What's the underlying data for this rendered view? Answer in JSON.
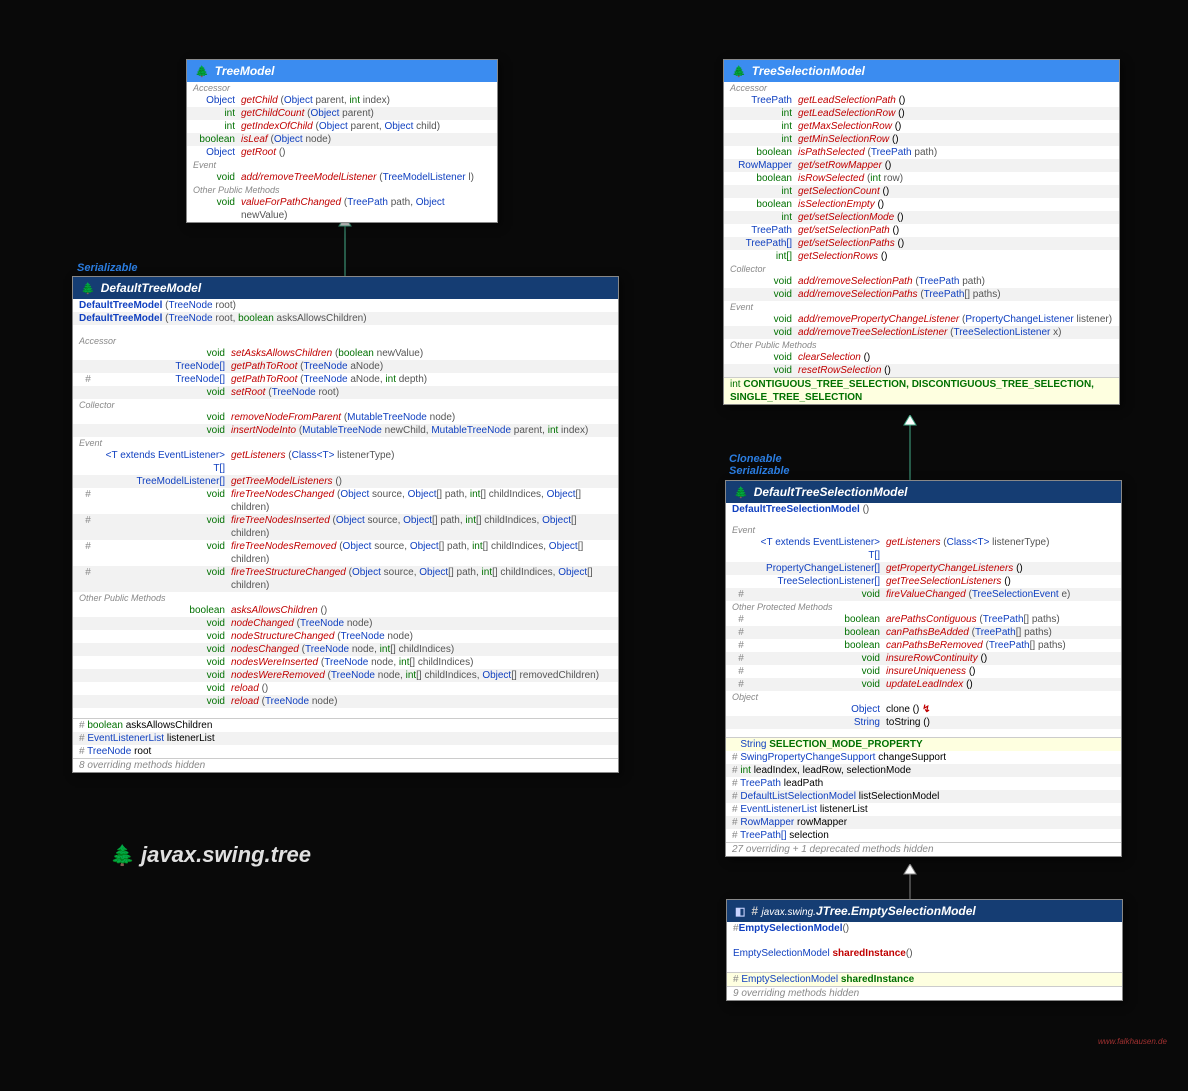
{
  "package_label": "javax.swing.tree",
  "watermark": "www.falkhausen.de",
  "stereotypes": {
    "serializable": "Serializable",
    "cloneable": "Cloneable"
  },
  "tree_model": {
    "title": "TreeModel",
    "sections": {
      "accessor": "Accessor",
      "event": "Event",
      "other": "Other Public Methods"
    },
    "rows": [
      {
        "ret": "Object",
        "retClass": "t-type",
        "name": "getChild",
        "params": "(Object parent, int index)"
      },
      {
        "ret": "int",
        "retClass": "t-prim",
        "name": "getChildCount",
        "params": "(Object parent)"
      },
      {
        "ret": "int",
        "retClass": "t-prim",
        "name": "getIndexOfChild",
        "params": "(Object parent, Object child)"
      },
      {
        "ret": "boolean",
        "retClass": "t-prim",
        "name": "isLeaf",
        "params": "(Object node)"
      },
      {
        "ret": "Object",
        "retClass": "t-type",
        "name": "getRoot",
        "params": "()"
      }
    ],
    "event_row": {
      "ret": "void",
      "retClass": "t-prim",
      "name": "add/removeTreeModelListener",
      "params": "(TreeModelListener l)"
    },
    "other_row": {
      "ret": "void",
      "retClass": "t-prim",
      "name": "valueForPathChanged",
      "params": "(TreePath path, Object newValue)"
    }
  },
  "default_tree_model": {
    "title": "DefaultTreeModel",
    "ctors": [
      {
        "name": "DefaultTreeModel",
        "params": "(TreeNode root)"
      },
      {
        "name": "DefaultTreeModel",
        "params": "(TreeNode root, boolean asksAllowsChildren)"
      }
    ],
    "sections": {
      "accessor": "Accessor",
      "collector": "Collector",
      "event": "Event",
      "other": "Other Public Methods"
    },
    "accessor": [
      {
        "mod": "",
        "ret": "void",
        "retClass": "t-prim",
        "name": "setAsksAllowsChildren",
        "params": "(boolean newValue)"
      },
      {
        "mod": "",
        "ret": "TreeNode[]",
        "retClass": "t-type",
        "name": "getPathToRoot",
        "params": "(TreeNode aNode)"
      },
      {
        "mod": "#",
        "ret": "TreeNode[]",
        "retClass": "t-type",
        "name": "getPathToRoot",
        "params": "(TreeNode aNode, int depth)"
      },
      {
        "mod": "",
        "ret": "void",
        "retClass": "t-prim",
        "name": "setRoot",
        "params": "(TreeNode root)"
      }
    ],
    "collector": [
      {
        "mod": "",
        "ret": "void",
        "retClass": "t-prim",
        "name": "removeNodeFromParent",
        "params": "(MutableTreeNode node)"
      },
      {
        "mod": "",
        "ret": "void",
        "retClass": "t-prim",
        "name": "insertNodeInto",
        "params": "(MutableTreeNode newChild, MutableTreeNode parent, int index)"
      }
    ],
    "event": [
      {
        "mod": "",
        "ret": "<T extends EventListener> T[]",
        "retClass": "t-type",
        "name": "getListeners",
        "params": "(Class<T> listenerType)"
      },
      {
        "mod": "",
        "ret": "TreeModelListener[]",
        "retClass": "t-type",
        "name": "getTreeModelListeners",
        "params": "()"
      },
      {
        "mod": "#",
        "ret": "void",
        "retClass": "t-prim",
        "name": "fireTreeNodesChanged",
        "params": "(Object source, Object[] path, int[] childIndices, Object[] children)"
      },
      {
        "mod": "#",
        "ret": "void",
        "retClass": "t-prim",
        "name": "fireTreeNodesInserted",
        "params": "(Object source, Object[] path, int[] childIndices, Object[] children)"
      },
      {
        "mod": "#",
        "ret": "void",
        "retClass": "t-prim",
        "name": "fireTreeNodesRemoved",
        "params": "(Object source, Object[] path, int[] childIndices, Object[] children)"
      },
      {
        "mod": "#",
        "ret": "void",
        "retClass": "t-prim",
        "name": "fireTreeStructureChanged",
        "params": "(Object source, Object[] path, int[] childIndices, Object[] children)"
      }
    ],
    "other": [
      {
        "mod": "",
        "ret": "boolean",
        "retClass": "t-prim",
        "name": "asksAllowsChildren",
        "params": "()"
      },
      {
        "mod": "",
        "ret": "void",
        "retClass": "t-prim",
        "name": "nodeChanged",
        "params": "(TreeNode node)"
      },
      {
        "mod": "",
        "ret": "void",
        "retClass": "t-prim",
        "name": "nodeStructureChanged",
        "params": "(TreeNode node)"
      },
      {
        "mod": "",
        "ret": "void",
        "retClass": "t-prim",
        "name": "nodesChanged",
        "params": "(TreeNode node, int[] childIndices)"
      },
      {
        "mod": "",
        "ret": "void",
        "retClass": "t-prim",
        "name": "nodesWereInserted",
        "params": "(TreeNode node, int[] childIndices)"
      },
      {
        "mod": "",
        "ret": "void",
        "retClass": "t-prim",
        "name": "nodesWereRemoved",
        "params": "(TreeNode node, int[] childIndices, Object[] removedChildren)"
      },
      {
        "mod": "",
        "ret": "void",
        "retClass": "t-prim",
        "name": "reload",
        "params": "()"
      },
      {
        "mod": "",
        "ret": "void",
        "retClass": "t-prim",
        "name": "reload",
        "params": "(TreeNode node)"
      }
    ],
    "fields": [
      {
        "mod": "#",
        "type": "boolean",
        "typeClass": "t-prim",
        "name": "asksAllowsChildren"
      },
      {
        "mod": "#",
        "type": "EventListenerList",
        "typeClass": "t-type",
        "name": "listenerList"
      },
      {
        "mod": "#",
        "type": "TreeNode",
        "typeClass": "t-type",
        "name": "root"
      }
    ],
    "footnote": "8 overriding methods hidden"
  },
  "tree_selection_model": {
    "title": "TreeSelectionModel",
    "sections": {
      "accessor": "Accessor",
      "collector": "Collector",
      "event": "Event",
      "other": "Other Public Methods"
    },
    "accessor": [
      {
        "ret": "TreePath",
        "retClass": "t-type",
        "name": "getLeadSelectionPath",
        "params": "()"
      },
      {
        "ret": "int",
        "retClass": "t-prim",
        "name": "getLeadSelectionRow",
        "params": "()"
      },
      {
        "ret": "int",
        "retClass": "t-prim",
        "name": "getMaxSelectionRow",
        "params": "()"
      },
      {
        "ret": "int",
        "retClass": "t-prim",
        "name": "getMinSelectionRow",
        "params": "()"
      },
      {
        "ret": "boolean",
        "retClass": "t-prim",
        "name": "isPathSelected",
        "params": "(TreePath path)"
      },
      {
        "ret": "RowMapper",
        "retClass": "t-type",
        "name": "get/setRowMapper",
        "params": "()"
      },
      {
        "ret": "boolean",
        "retClass": "t-prim",
        "name": "isRowSelected",
        "params": "(int row)"
      },
      {
        "ret": "int",
        "retClass": "t-prim",
        "name": "getSelectionCount",
        "params": "()"
      },
      {
        "ret": "boolean",
        "retClass": "t-prim",
        "name": "isSelectionEmpty",
        "params": "()"
      },
      {
        "ret": "int",
        "retClass": "t-prim",
        "name": "get/setSelectionMode",
        "params": "()"
      },
      {
        "ret": "TreePath",
        "retClass": "t-type",
        "name": "get/setSelectionPath",
        "params": "()"
      },
      {
        "ret": "TreePath[]",
        "retClass": "t-type",
        "name": "get/setSelectionPaths",
        "params": "()"
      },
      {
        "ret": "int[]",
        "retClass": "t-prim",
        "name": "getSelectionRows",
        "params": "()"
      }
    ],
    "collector": [
      {
        "ret": "void",
        "retClass": "t-prim",
        "name": "add/removeSelectionPath",
        "params": "(TreePath path)"
      },
      {
        "ret": "void",
        "retClass": "t-prim",
        "name": "add/removeSelectionPaths",
        "params": "(TreePath[] paths)"
      }
    ],
    "event": [
      {
        "ret": "void",
        "retClass": "t-prim",
        "name": "add/removePropertyChangeListener",
        "params": "(PropertyChangeListener listener)"
      },
      {
        "ret": "void",
        "retClass": "t-prim",
        "name": "add/removeTreeSelectionListener",
        "params": "(TreeSelectionListener x)"
      }
    ],
    "other": [
      {
        "ret": "void",
        "retClass": "t-prim",
        "name": "clearSelection",
        "params": "()"
      },
      {
        "ret": "void",
        "retClass": "t-prim",
        "name": "resetRowSelection",
        "params": "()"
      }
    ],
    "constants_prefix": "int",
    "constants": "CONTIGUOUS_TREE_SELECTION, DISCONTIGUOUS_TREE_SELECTION, SINGLE_TREE_SELECTION"
  },
  "default_tree_selection_model": {
    "title": "DefaultTreeSelectionModel",
    "ctor": {
      "name": "DefaultTreeSelectionModel",
      "params": "()"
    },
    "sections": {
      "event": "Event",
      "protected": "Other Protected Methods",
      "object": "Object"
    },
    "event": [
      {
        "mod": "",
        "ret": "<T extends EventListener> T[]",
        "retClass": "t-type",
        "name": "getListeners",
        "params": "(Class<T> listenerType)"
      },
      {
        "mod": "",
        "ret": "PropertyChangeListener[]",
        "retClass": "t-type",
        "name": "getPropertyChangeListeners",
        "params": "()"
      },
      {
        "mod": "",
        "ret": "TreeSelectionListener[]",
        "retClass": "t-type",
        "name": "getTreeSelectionListeners",
        "params": "()"
      },
      {
        "mod": "#",
        "ret": "void",
        "retClass": "t-prim",
        "name": "fireValueChanged",
        "params": "(TreeSelectionEvent e)"
      }
    ],
    "protected": [
      {
        "mod": "#",
        "ret": "boolean",
        "retClass": "t-prim",
        "name": "arePathsContiguous",
        "params": "(TreePath[] paths)"
      },
      {
        "mod": "#",
        "ret": "boolean",
        "retClass": "t-prim",
        "name": "canPathsBeAdded",
        "params": "(TreePath[] paths)"
      },
      {
        "mod": "#",
        "ret": "boolean",
        "retClass": "t-prim",
        "name": "canPathsBeRemoved",
        "params": "(TreePath[] paths)"
      },
      {
        "mod": "#",
        "ret": "void",
        "retClass": "t-prim",
        "name": "insureRowContinuity",
        "params": "()"
      },
      {
        "mod": "#",
        "ret": "void",
        "retClass": "t-prim",
        "name": "insureUniqueness",
        "params": "()"
      },
      {
        "mod": "#",
        "ret": "void",
        "retClass": "t-prim",
        "name": "updateLeadIndex",
        "params": "()"
      }
    ],
    "object": [
      {
        "mod": "",
        "ret": "Object",
        "retClass": "t-type",
        "name": "clone",
        "params": "() ",
        "suffixClass": "t-static",
        "suffix": "↯"
      },
      {
        "mod": "",
        "ret": "String",
        "retClass": "t-type",
        "name": "toString",
        "nameClass": "",
        "params": "()"
      }
    ],
    "const_field": {
      "type": "String",
      "typeClass": "t-type",
      "name": "SELECTION_MODE_PROPERTY"
    },
    "fields": [
      {
        "mod": "#",
        "type": "SwingPropertyChangeSupport",
        "typeClass": "t-type",
        "name": "changeSupport"
      },
      {
        "mod": "#",
        "type": "int",
        "typeClass": "t-prim",
        "name": "leadIndex, leadRow, selectionMode"
      },
      {
        "mod": "#",
        "type": "TreePath",
        "typeClass": "t-type",
        "name": "leadPath"
      },
      {
        "mod": "#",
        "type": "DefaultListSelectionModel",
        "typeClass": "t-type",
        "name": "listSelectionModel"
      },
      {
        "mod": "#",
        "type": "EventListenerList",
        "typeClass": "t-type",
        "name": "listenerList"
      },
      {
        "mod": "#",
        "type": "RowMapper",
        "typeClass": "t-type",
        "name": "rowMapper"
      },
      {
        "mod": "#",
        "type": "TreePath[]",
        "typeClass": "t-type",
        "name": "selection"
      }
    ],
    "footnote": "27 overriding + 1 deprecated methods hidden"
  },
  "empty_selection_model": {
    "prefix": "javax.swing.",
    "title": "JTree.EmptySelectionModel",
    "ctor": {
      "mod": "#",
      "name": "EmptySelectionModel",
      "params": "()"
    },
    "method": {
      "ret": "EmptySelectionModel",
      "retClass": "t-type",
      "name": "sharedInstance",
      "params": "()"
    },
    "field": {
      "mod": "#",
      "type": "EmptySelectionModel",
      "typeClass": "t-type",
      "name": "sharedInstance"
    },
    "footnote": "9 overriding methods hidden"
  }
}
